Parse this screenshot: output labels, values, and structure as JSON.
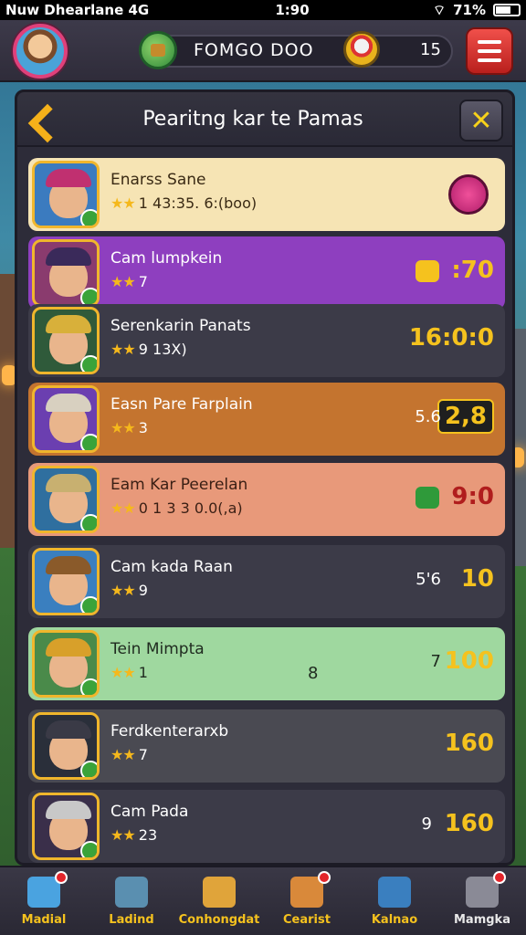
{
  "status_bar": {
    "carrier": "Nuw Dhearlane 4G",
    "time": "1:90",
    "battery": "71%"
  },
  "hud": {
    "resource_label": "FOMGO DOO",
    "resource_count": "15"
  },
  "panel": {
    "title": "Pearitng kar te Pamas"
  },
  "rows": [
    {
      "title": "Enarss Sane",
      "stars": "★★",
      "sub": "1 43:35. 6:(boo)",
      "value": "",
      "pre": "",
      "bg": "#f6e4b4",
      "text": "#3a2a14"
    },
    {
      "title": "Cam lumpkein",
      "stars": "★★",
      "sub": "7",
      "value": ":70",
      "pre": "",
      "bg": "#8e3fbf",
      "text": "#ffffff"
    },
    {
      "title": "Serenkarin Panats",
      "stars": "★★",
      "sub": "9 13X)",
      "value": "16:0:0",
      "pre": "",
      "bg": "#3c3b48",
      "text": "#ffffff"
    },
    {
      "title": "Easn Pare Farplain",
      "stars": "★★",
      "sub": "3",
      "value": "2,8",
      "pre": "5.6",
      "bg": "#c4742f",
      "text": "#ffffff"
    },
    {
      "title": "Eam Kar Peerelan",
      "stars": "★★",
      "sub": "0 1 3 3 0.0(,a)",
      "value": "9:0",
      "pre": "",
      "bg": "#e8997a",
      "text": "#3a1f14"
    },
    {
      "title": "Cam kada Raan",
      "stars": "★★",
      "sub": "9",
      "value": "10",
      "pre": "5'6",
      "bg": "#3c3b48",
      "text": "#ffffff"
    },
    {
      "title": "Tein Mimpta",
      "stars": "★★",
      "sub": "1",
      "value": "100",
      "pre": "7",
      "mid": "8",
      "bg": "#9fd89f",
      "text": "#1f2a1f"
    },
    {
      "title": "Ferdkenterarxb",
      "stars": "★★",
      "sub": "7",
      "value": "160",
      "pre": "",
      "bg": "#4a4a52",
      "text": "#ffffff"
    },
    {
      "title": "Cam Pada",
      "stars": "★★",
      "sub": "23",
      "value": "160",
      "pre": "9",
      "bg": "#3c3b48",
      "text": "#ffffff"
    }
  ],
  "nav": [
    {
      "label": "Madial",
      "icon": "cube-icon",
      "color": "#4aa3e0",
      "dot": true
    },
    {
      "label": "Ladind",
      "icon": "sword-icon",
      "color": "#5a8fb0",
      "dot": false
    },
    {
      "label": "Conhongdat",
      "icon": "chest-icon",
      "color": "#e0a43a",
      "dot": false
    },
    {
      "label": "Cearist",
      "icon": "shop-icon",
      "color": "#d9893a",
      "dot": true
    },
    {
      "label": "Kalnao",
      "icon": "shield-icon",
      "color": "#3a7fbf",
      "dot": false
    },
    {
      "label": "Mamgka",
      "icon": "settings-icon",
      "color": "#8a8a96",
      "dot": true
    }
  ]
}
